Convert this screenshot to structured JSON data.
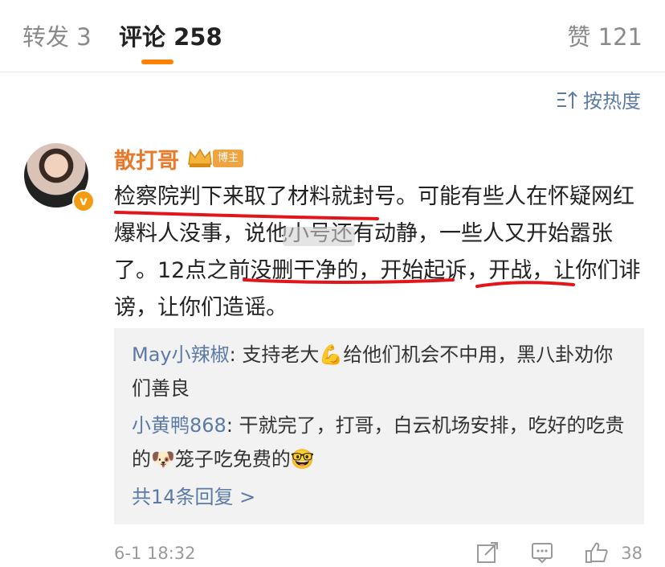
{
  "tabs": {
    "repost": "转发 3",
    "comments": "评论 258",
    "likes": "赞 121"
  },
  "sort": {
    "label": "按热度",
    "icon": "sort-icon"
  },
  "comment": {
    "author": "散打哥",
    "badge": "博主",
    "text": "检察院判下来取了材料就封号。可能有些人在怀疑网红爆料人没事，说他小号还有动静，一些人又开始嚣张了。12点之前没删干净的，开始起诉，开战，让你们诽谤，让你们造谣。",
    "time": "6-1 18:32",
    "likes": "38"
  },
  "replies": [
    {
      "user": "May小辣椒",
      "text": ": 支持老大💪给他们机会不中用，黑八卦劝你们善良"
    },
    {
      "user": "小黄鸭868",
      "text": ": 干就完了，打哥，白云机场安排，吃好的吃贵的🐶笼子吃免费的🤓"
    }
  ],
  "more_replies": "共14条回复 >",
  "colors": {
    "accent": "#ff8200",
    "link": "#5b7aa8",
    "author": "#e8792a",
    "underline": "#e0161b"
  }
}
